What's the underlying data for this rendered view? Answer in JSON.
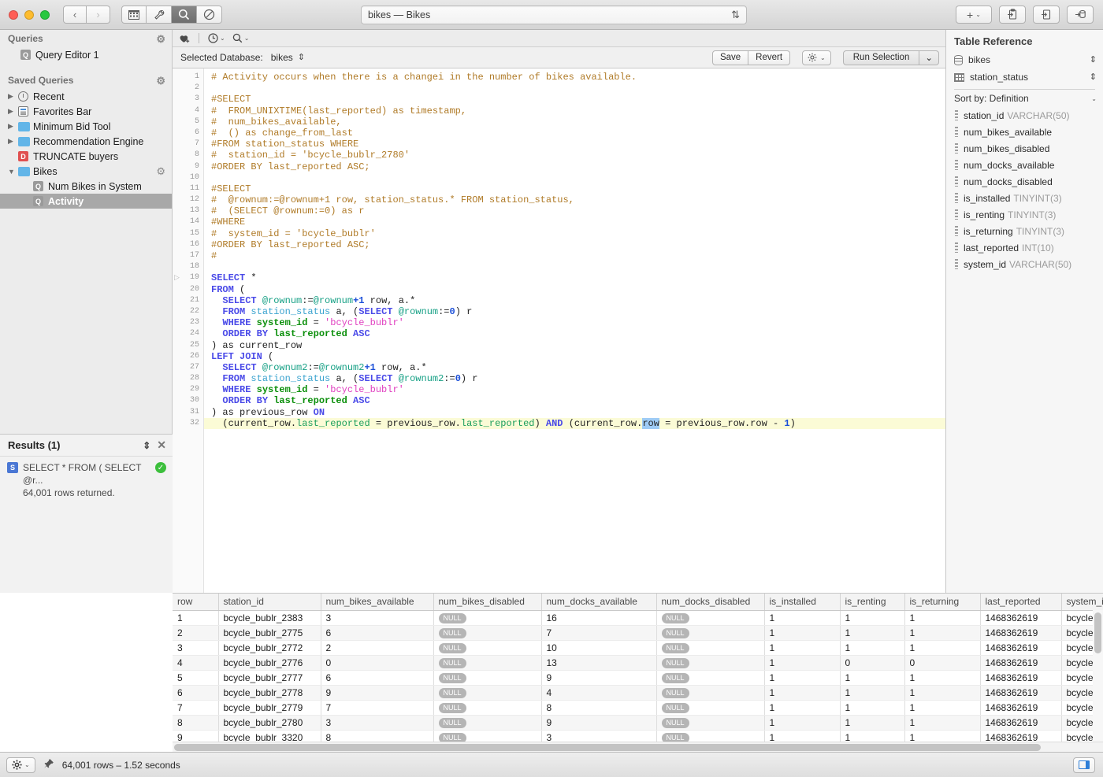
{
  "window": {
    "title": "bikes — Bikes",
    "sort_icon": "sort-arrows-icon",
    "nav_back": "‹",
    "nav_forward": "›",
    "toolbar_icons": [
      "grid-icon",
      "wrench-icon",
      "search-icon",
      "no-entry-icon"
    ],
    "right_buttons": [
      "add-plus-button",
      "paste-clipboard-button",
      "import-button",
      "export-db-button"
    ]
  },
  "sidebar": {
    "queries_header": "Queries",
    "queries_items": [
      {
        "label": "Query Editor 1",
        "icon": "query-icon"
      }
    ],
    "saved_header": "Saved Queries",
    "saved_items": [
      {
        "label": "Recent",
        "icon": "clock-icon",
        "twisty": "▶",
        "indent": 0,
        "selected": false
      },
      {
        "label": "Favorites Bar",
        "icon": "list-icon",
        "twisty": "▶",
        "indent": 0,
        "selected": false
      },
      {
        "label": "Minimum Bid Tool",
        "icon": "folder-icon",
        "twisty": "▶",
        "indent": 0,
        "selected": false
      },
      {
        "label": "Recommendation Engine",
        "icon": "folder-icon",
        "twisty": "▶",
        "indent": 0,
        "selected": false
      },
      {
        "label": "TRUNCATE buyers",
        "icon": "doc-icon",
        "twisty": "",
        "indent": 0,
        "selected": false
      },
      {
        "label": "Bikes",
        "icon": "folder-icon",
        "twisty": "▼",
        "indent": 0,
        "selected": false,
        "gear": true
      },
      {
        "label": "Num Bikes in System",
        "icon": "query-icon",
        "twisty": "",
        "indent": 1,
        "selected": false
      },
      {
        "label": "Activity",
        "icon": "query-icon",
        "twisty": "",
        "indent": 1,
        "selected": true
      }
    ]
  },
  "results_panel": {
    "title": "Results (1)",
    "updown_icon": "stepper-icon",
    "close_icon": "close-icon",
    "item_badge": "S",
    "item_query": "SELECT * FROM ( SELECT @r...",
    "item_rows": "64,001 rows returned.",
    "status_icon": "success-check-icon"
  },
  "editor_toolbar": {
    "favorite_icon": "heart-plus-icon",
    "history_icon": "clock-icon",
    "search_icon": "search-icon",
    "caret": "⌄"
  },
  "db_bar": {
    "label": "Selected Database:",
    "value": "bikes",
    "stepper_icon": "updown-stepper-icon",
    "save_label": "Save",
    "revert_label": "Revert",
    "gear_icon": "gear-icon",
    "run_label": "Run Selection",
    "run_caret": "⌄"
  },
  "editor": {
    "highlight_line": 32,
    "fold_line": 19,
    "lines": [
      {
        "n": 1,
        "html": "<span class='cm'># Activity occurs when there is a changei in the number of bikes available.</span>"
      },
      {
        "n": 2,
        "html": ""
      },
      {
        "n": 3,
        "html": "<span class='cm'>#SELECT</span>"
      },
      {
        "n": 4,
        "html": "<span class='cm'>#  FROM_UNIXTIME(last_reported) as timestamp,</span>"
      },
      {
        "n": 5,
        "html": "<span class='cm'>#  num_bikes_available,</span>"
      },
      {
        "n": 6,
        "html": "<span class='cm'>#  () as change_from_last</span>"
      },
      {
        "n": 7,
        "html": "<span class='cm'>#FROM station_status WHERE</span>"
      },
      {
        "n": 8,
        "html": "<span class='cm'>#  station_id = 'bcycle_bublr_2780'</span>"
      },
      {
        "n": 9,
        "html": "<span class='cm'>#ORDER BY last_reported ASC;</span>"
      },
      {
        "n": 10,
        "html": ""
      },
      {
        "n": 11,
        "html": "<span class='cm'>#SELECT</span>"
      },
      {
        "n": 12,
        "html": "<span class='cm'>#  @rownum:=@rownum+1 row, station_status.* FROM station_status,</span>"
      },
      {
        "n": 13,
        "html": "<span class='cm'>#  (SELECT @rownum:=0) as r</span>"
      },
      {
        "n": 14,
        "html": "<span class='cm'>#WHERE</span>"
      },
      {
        "n": 15,
        "html": "<span class='cm'>#  system_id = 'bcycle_bublr'</span>"
      },
      {
        "n": 16,
        "html": "<span class='cm'>#ORDER BY last_reported ASC;</span>"
      },
      {
        "n": 17,
        "html": "<span class='cm'>#</span>"
      },
      {
        "n": 18,
        "html": ""
      },
      {
        "n": 19,
        "html": "<span class='kw'>SELECT</span> *"
      },
      {
        "n": 20,
        "html": "<span class='kw'>FROM</span> ("
      },
      {
        "n": 21,
        "html": "  <span class='kw'>SELECT</span> <span class='var'>@rownum</span>:=<span class='var'>@rownum</span><span class='num'>+1</span> row, a.*"
      },
      {
        "n": 22,
        "html": "  <span class='kw'>FROM</span> <span class='tbl'>station_status</span> a, (<span class='kw'>SELECT</span> <span class='var'>@rownum</span>:=<span class='num'>0</span>) r"
      },
      {
        "n": 23,
        "html": "  <span class='kw'>WHERE</span> <span class='kw2'>system_id</span> = <span class='str'>'bcycle_bublr'</span>"
      },
      {
        "n": 24,
        "html": "  <span class='kw'>ORDER BY</span> <span class='kw2'>last_reported</span> <span class='kw'>ASC</span>"
      },
      {
        "n": 25,
        "html": ") as current_row"
      },
      {
        "n": 26,
        "html": "<span class='kw'>LEFT JOIN</span> ("
      },
      {
        "n": 27,
        "html": "  <span class='kw'>SELECT</span> <span class='var'>@rownum2</span>:=<span class='var'>@rownum2</span><span class='num'>+1</span> row, a.*"
      },
      {
        "n": 28,
        "html": "  <span class='kw'>FROM</span> <span class='tbl'>station_status</span> a, (<span class='kw'>SELECT</span> <span class='var'>@rownum2</span>:=<span class='num'>0</span>) r"
      },
      {
        "n": 29,
        "html": "  <span class='kw'>WHERE</span> <span class='kw2'>system_id</span> = <span class='str'>'bcycle_bublr'</span>"
      },
      {
        "n": 30,
        "html": "  <span class='kw'>ORDER BY</span> <span class='kw2'>last_reported</span> <span class='kw'>ASC</span>"
      },
      {
        "n": 31,
        "html": ") as previous_row <span class='kw'>ON</span>"
      },
      {
        "n": 32,
        "html": "  (current_row.<span class='fld'>last_reported</span> = previous_row.<span class='fld'>last_reported</span>) <span class='kw'>AND</span> (current_row.<span class='sel-tok'>row</span> = previous_row.row <span class='op'>-</span> <span class='num'>1</span>)"
      }
    ]
  },
  "table_reference": {
    "title": "Table Reference",
    "database": "bikes",
    "table": "station_status",
    "sort_label": "Sort by: Definition",
    "sort_caret": "⌄",
    "columns": [
      {
        "name": "station_id",
        "type": "VARCHAR(50)"
      },
      {
        "name": "num_bikes_available",
        "type": ""
      },
      {
        "name": "num_bikes_disabled",
        "type": ""
      },
      {
        "name": "num_docks_available",
        "type": ""
      },
      {
        "name": "num_docks_disabled",
        "type": ""
      },
      {
        "name": "is_installed",
        "type": "TINYINT(3)"
      },
      {
        "name": "is_renting",
        "type": "TINYINT(3)"
      },
      {
        "name": "is_returning",
        "type": "TINYINT(3)"
      },
      {
        "name": "last_reported",
        "type": "INT(10)"
      },
      {
        "name": "system_id",
        "type": "VARCHAR(50)"
      }
    ]
  },
  "results_grid": {
    "headers": [
      "row",
      "station_id",
      "num_bikes_available",
      "num_bikes_disabled",
      "num_docks_available",
      "num_docks_disabled",
      "is_installed",
      "is_renting",
      "is_returning",
      "last_reported",
      "system_i"
    ],
    "rows": [
      [
        "1",
        "bcycle_bublr_2383",
        "3",
        "NULL",
        "16",
        "NULL",
        "1",
        "1",
        "1",
        "1468362619",
        "bcycle_b"
      ],
      [
        "2",
        "bcycle_bublr_2775",
        "6",
        "NULL",
        "7",
        "NULL",
        "1",
        "1",
        "1",
        "1468362619",
        "bcycle_b"
      ],
      [
        "3",
        "bcycle_bublr_2772",
        "2",
        "NULL",
        "10",
        "NULL",
        "1",
        "1",
        "1",
        "1468362619",
        "bcycle_b"
      ],
      [
        "4",
        "bcycle_bublr_2776",
        "0",
        "NULL",
        "13",
        "NULL",
        "1",
        "0",
        "0",
        "1468362619",
        "bcycle_b"
      ],
      [
        "5",
        "bcycle_bublr_2777",
        "6",
        "NULL",
        "9",
        "NULL",
        "1",
        "1",
        "1",
        "1468362619",
        "bcycle_b"
      ],
      [
        "6",
        "bcycle_bublr_2778",
        "9",
        "NULL",
        "4",
        "NULL",
        "1",
        "1",
        "1",
        "1468362619",
        "bcycle_b"
      ],
      [
        "7",
        "bcycle_bublr_2779",
        "7",
        "NULL",
        "8",
        "NULL",
        "1",
        "1",
        "1",
        "1468362619",
        "bcycle_b"
      ],
      [
        "8",
        "bcycle_bublr_2780",
        "3",
        "NULL",
        "9",
        "NULL",
        "1",
        "1",
        "1",
        "1468362619",
        "bcycle_b"
      ],
      [
        "9",
        "bcycle_bublr_3320",
        "8",
        "NULL",
        "3",
        "NULL",
        "1",
        "1",
        "1",
        "1468362619",
        "bcycle_b"
      ]
    ]
  },
  "statusbar": {
    "gear_icon": "gear-icon",
    "gear_caret": "⌄",
    "pin_icon": "pin-icon",
    "text": "64,001 rows – 1.52 seconds",
    "panel_toggle_icon": "right-panel-toggle-icon"
  }
}
